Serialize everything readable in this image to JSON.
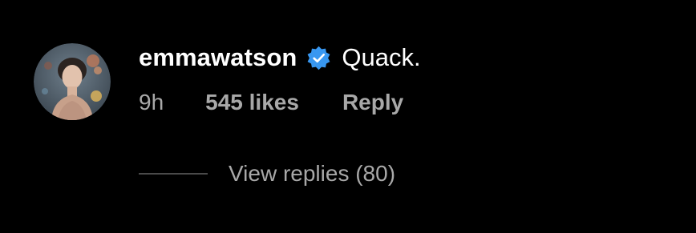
{
  "comment": {
    "avatar_icon": "profile-photo",
    "username": "emmawatson",
    "verified_icon": "verified-badge-icon",
    "verified_color": "#3897f0",
    "text": "Quack.",
    "timestamp": "9h",
    "likes_label": "545 likes",
    "reply_label": "Reply",
    "view_replies_label": "View replies (80)"
  },
  "theme": {
    "background": "#000000",
    "primary_text": "#ffffff",
    "secondary_text": "#a8a8a8"
  }
}
